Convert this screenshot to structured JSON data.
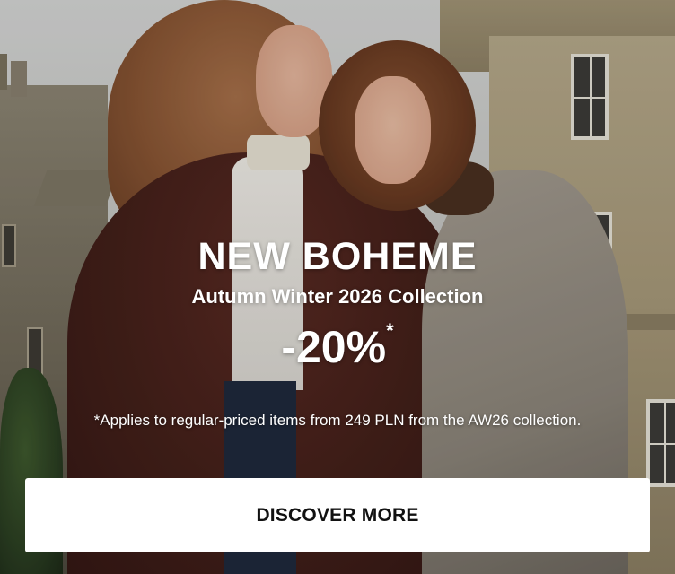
{
  "banner": {
    "headline": "NEW BOHEME",
    "subheadline": "Autumn Winter 2026 Collection",
    "discount": "-20%",
    "discount_marker": "*",
    "disclaimer": "*Applies to regular-priced items from 249 PLN from the AW26 collection.",
    "cta_label": "DISCOVER MORE"
  },
  "colors": {
    "text": "#ffffff",
    "button_bg": "#ffffff",
    "button_text": "#111111"
  }
}
